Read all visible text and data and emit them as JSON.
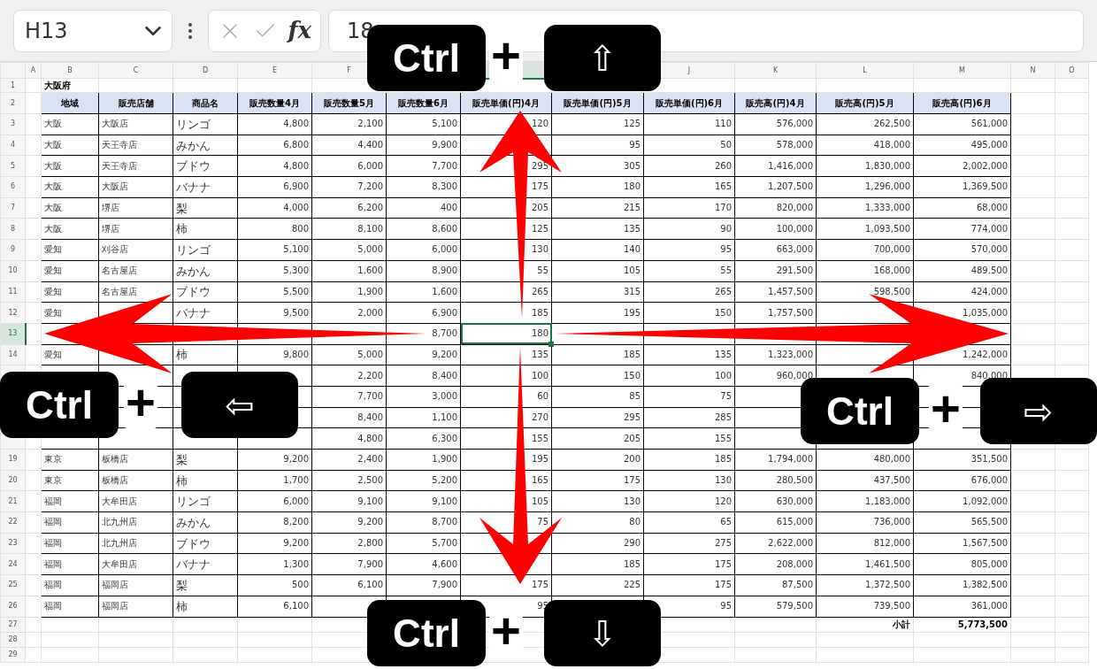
{
  "name_box": {
    "value": "H13"
  },
  "formula_bar": {
    "function_label": "fx",
    "value": "18"
  },
  "columns": [
    {
      "letter": "A",
      "selected": false
    },
    {
      "letter": "B",
      "selected": false
    },
    {
      "letter": "C",
      "selected": false
    },
    {
      "letter": "D",
      "selected": false
    },
    {
      "letter": "E",
      "selected": false
    },
    {
      "letter": "F",
      "selected": false
    },
    {},
    {
      "selected": true
    },
    {},
    {
      "letter": "J",
      "selected": false
    },
    {
      "letter": "K",
      "selected": false
    },
    {
      "letter": "L",
      "selected": false
    },
    {
      "letter": "M",
      "selected": false
    },
    {
      "letter": "N",
      "selected": false
    },
    {
      "letter": "O",
      "selected": false
    }
  ],
  "rows": [
    {
      "number": "1",
      "kind": "title",
      "selected": false,
      "cells": [
        null,
        "大阪府",
        null,
        null,
        null,
        null,
        null,
        null,
        null,
        null,
        null,
        null,
        null,
        null,
        null
      ]
    },
    {
      "number": "2",
      "kind": "header",
      "selected": false,
      "cells": [
        null,
        "地域",
        "販売店舗",
        "商品名",
        "販売数量4月",
        "販売数量5月",
        "販売数量6月",
        "販売単価(円)4月",
        "販売単価(円)5月",
        "販売単価(円)6月",
        "販売高(円)4月",
        "販売高(円)5月",
        "販売高(円)6月",
        null,
        null
      ]
    },
    {
      "number": "3",
      "kind": "data",
      "selected": false,
      "cells": [
        null,
        "大阪",
        "大阪店",
        "リンゴ",
        "4,800",
        "2,100",
        "5,100",
        "120",
        "125",
        "110",
        "576,000",
        "262,500",
        "561,000",
        null,
        null
      ]
    },
    {
      "number": "4",
      "kind": "data",
      "selected": false,
      "cells": [
        null,
        "大阪",
        "天王寺店",
        "みかん",
        "6,800",
        "4,400",
        "9,900",
        null,
        "95",
        "50",
        "578,000",
        "418,000",
        "495,000",
        null,
        null
      ]
    },
    {
      "number": "5",
      "kind": "data",
      "selected": false,
      "cells": [
        null,
        "大阪",
        "天王寺店",
        "ブドウ",
        "4,800",
        "6,000",
        "7,700",
        "295",
        "305",
        "260",
        "1,416,000",
        "1,830,000",
        "2,002,000",
        null,
        null
      ]
    },
    {
      "number": "6",
      "kind": "data",
      "selected": false,
      "cells": [
        null,
        "大阪",
        "大阪店",
        "バナナ",
        "6,900",
        "7,200",
        "8,300",
        "175",
        "180",
        "165",
        "1,207,500",
        "1,296,000",
        "1,369,500",
        null,
        null
      ]
    },
    {
      "number": "7",
      "kind": "data",
      "selected": false,
      "cells": [
        null,
        "大阪",
        "堺店",
        "梨",
        "4,000",
        "6,200",
        "400",
        "205",
        "215",
        "170",
        "820,000",
        "1,333,000",
        "68,000",
        null,
        null
      ]
    },
    {
      "number": "8",
      "kind": "data",
      "selected": false,
      "cells": [
        null,
        "大阪",
        "堺店",
        "柿",
        "800",
        "8,100",
        "8,600",
        "125",
        "135",
        "90",
        "100,000",
        "1,093,500",
        "774,000",
        null,
        null
      ]
    },
    {
      "number": "9",
      "kind": "data",
      "selected": false,
      "cells": [
        null,
        "愛知",
        "刈谷店",
        "リンゴ",
        "5,100",
        "5,000",
        "6,000",
        "130",
        "140",
        "95",
        "663,000",
        "700,000",
        "570,000",
        null,
        null
      ]
    },
    {
      "number": "10",
      "kind": "data",
      "selected": false,
      "cells": [
        null,
        "愛知",
        "名古屋店",
        "みかん",
        "5,300",
        "1,600",
        "8,900",
        "55",
        "105",
        "55",
        "291,500",
        "168,000",
        "489,500",
        null,
        null
      ]
    },
    {
      "number": "11",
      "kind": "data",
      "selected": false,
      "cells": [
        null,
        "愛知",
        "名古屋店",
        "ブドウ",
        "5,500",
        "1,900",
        "1,600",
        "265",
        "315",
        "265",
        "1,457,500",
        "598,500",
        "424,000",
        null,
        null
      ]
    },
    {
      "number": "12",
      "kind": "data",
      "selected": false,
      "cells": [
        null,
        "愛知",
        null,
        "バナナ",
        "9,500",
        "2,000",
        "6,900",
        "185",
        "195",
        "150",
        "1,757,500",
        null,
        "1,035,000",
        null,
        null
      ]
    },
    {
      "number": "13",
      "kind": "data",
      "selected": true,
      "cells": [
        null,
        null,
        null,
        null,
        null,
        null,
        "8,700",
        "180",
        null,
        null,
        null,
        null,
        null,
        null,
        null
      ]
    },
    {
      "number": "14",
      "kind": "data",
      "selected": false,
      "cells": [
        null,
        "愛知",
        null,
        "柿",
        "9,800",
        "5,000",
        "9,200",
        "135",
        "185",
        "135",
        "1,323,000",
        null,
        "1,242,000",
        null,
        null
      ]
    },
    {
      "kind": "data",
      "selected": false,
      "cells": [
        null,
        null,
        null,
        null,
        null,
        "2,200",
        "8,400",
        "100",
        "150",
        "100",
        "960,000",
        null,
        "840,000",
        null,
        null
      ]
    },
    {
      "kind": "data",
      "cells": [
        null,
        null,
        null,
        null,
        null,
        "7,700",
        "3,000",
        "60",
        "85",
        "75",
        null,
        null,
        null,
        null,
        null
      ]
    },
    {
      "kind": "data",
      "cells": [
        null,
        null,
        null,
        null,
        null,
        "8,400",
        "1,100",
        "270",
        "295",
        "285",
        null,
        null,
        null,
        null,
        null
      ]
    },
    {
      "kind": "data",
      "selected": false,
      "cells": [
        null,
        null,
        null,
        null,
        null,
        "4,800",
        "6,300",
        "155",
        "205",
        "155",
        null,
        null,
        null,
        null,
        null
      ]
    },
    {
      "number": "19",
      "kind": "data",
      "selected": false,
      "cells": [
        null,
        "東京",
        "板橋店",
        "梨",
        "9,200",
        "2,400",
        "1,900",
        "195",
        "200",
        "185",
        "1,794,000",
        "480,000",
        "351,500",
        null,
        null
      ]
    },
    {
      "number": "20",
      "kind": "data",
      "selected": false,
      "cells": [
        null,
        "東京",
        "板橋店",
        "柿",
        "1,700",
        "2,500",
        "5,200",
        "165",
        "175",
        "130",
        "280,500",
        "437,500",
        "676,000",
        null,
        null
      ]
    },
    {
      "number": "21",
      "kind": "data",
      "selected": false,
      "cells": [
        null,
        "福岡",
        "大牟田店",
        "リンゴ",
        "6,000",
        "9,100",
        "9,100",
        "105",
        "130",
        "120",
        "630,000",
        "1,183,000",
        "1,092,000",
        null,
        null
      ]
    },
    {
      "number": "22",
      "kind": "data",
      "selected": false,
      "cells": [
        null,
        "福岡",
        "北九州店",
        "みかん",
        "8,200",
        "9,200",
        "8,700",
        "75",
        "80",
        "65",
        "615,000",
        "736,000",
        "565,500",
        null,
        null
      ]
    },
    {
      "number": "23",
      "kind": "data",
      "selected": false,
      "cells": [
        null,
        "福岡",
        "北九州店",
        "ブドウ",
        "9,200",
        "2,800",
        "5,700",
        null,
        "290",
        "275",
        "2,622,000",
        "812,000",
        "1,567,500",
        null,
        null
      ]
    },
    {
      "number": "24",
      "kind": "data",
      "selected": false,
      "cells": [
        null,
        "福岡",
        "大牟田店",
        "バナナ",
        "1,300",
        "7,900",
        "4,600",
        null,
        "185",
        "175",
        "208,000",
        "1,461,500",
        "805,000",
        null,
        null
      ]
    },
    {
      "number": "25",
      "kind": "data",
      "selected": false,
      "cells": [
        null,
        "福岡",
        "福岡店",
        "梨",
        "500",
        "6,100",
        "7,900",
        "175",
        "225",
        "175",
        "87,500",
        "1,372,500",
        "1,382,500",
        null,
        null
      ]
    },
    {
      "number": "26",
      "kind": "data",
      "selected": false,
      "cells": [
        null,
        "福岡",
        "福岡店",
        "柿",
        "6,100",
        null,
        null,
        "95",
        null,
        "95",
        "579,500",
        "739,500",
        "361,000",
        null,
        null
      ]
    },
    {
      "number": "27",
      "kind": "total",
      "selected": false,
      "cells": [
        null,
        null,
        null,
        null,
        null,
        null,
        null,
        null,
        null,
        null,
        null,
        "小計",
        "5,773,500",
        null,
        null
      ]
    },
    {
      "number": "28",
      "kind": "blank",
      "selected": false,
      "cells": [
        null,
        null,
        null,
        null,
        null,
        null,
        null,
        null,
        null,
        null,
        null,
        null,
        null,
        null,
        null
      ]
    },
    {
      "number": "29",
      "kind": "blank",
      "selected": false,
      "cells": [
        null,
        null,
        null,
        null,
        null,
        null,
        null,
        null,
        null,
        null,
        null,
        null,
        null,
        null,
        null
      ]
    }
  ],
  "shortcuts": [
    {
      "kind": "up",
      "modifier": "Ctrl",
      "joiner": "+",
      "key": "⇧"
    },
    {
      "kind": "left",
      "modifier": "Ctrl",
      "joiner": "+",
      "key": "⇦"
    },
    {
      "kind": "right",
      "modifier": "Ctrl",
      "joiner": "+",
      "key": "⇨"
    },
    {
      "kind": "down",
      "modifier": "Ctrl",
      "joiner": "+",
      "key": "⇩"
    }
  ]
}
